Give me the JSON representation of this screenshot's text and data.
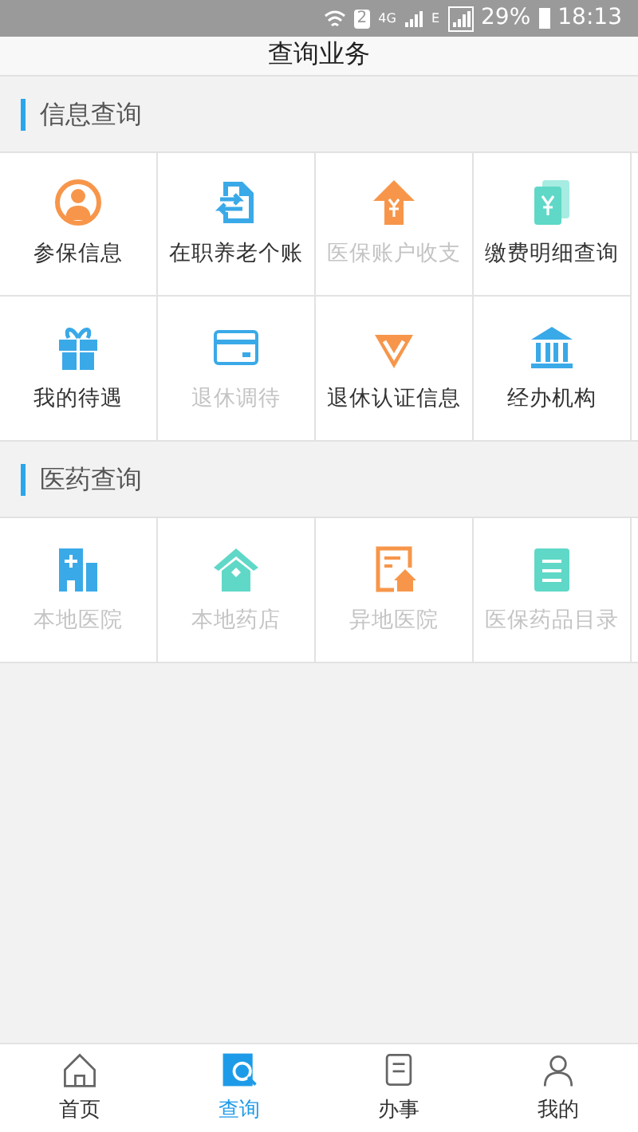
{
  "status_bar": {
    "sim": "2",
    "network": "4G",
    "network_2": "E",
    "battery": "29%",
    "time": "18:13"
  },
  "header": {
    "title": "查询业务"
  },
  "sections": [
    {
      "title": "信息查询",
      "items": [
        {
          "label": "参保信息",
          "disabled": false,
          "kind": "person"
        },
        {
          "label": "在职养老个账",
          "disabled": false,
          "kind": "transfer"
        },
        {
          "label": "医保账户收支",
          "disabled": true,
          "kind": "upload"
        },
        {
          "label": "缴费明细查询",
          "disabled": false,
          "kind": "bill"
        },
        {
          "label": "我的待遇",
          "disabled": false,
          "kind": "gift"
        },
        {
          "label": "退休调待",
          "disabled": true,
          "kind": "card"
        },
        {
          "label": "退休认证信息",
          "disabled": false,
          "kind": "diamond"
        },
        {
          "label": "经办机构",
          "disabled": false,
          "kind": "bank"
        }
      ]
    },
    {
      "title": "医药查询",
      "items": [
        {
          "label": "本地医院",
          "disabled": true,
          "kind": "hospital"
        },
        {
          "label": "本地药店",
          "disabled": true,
          "kind": "house"
        },
        {
          "label": "异地医院",
          "disabled": true,
          "kind": "dochouse"
        },
        {
          "label": "医保药品目录",
          "disabled": true,
          "kind": "list"
        }
      ]
    }
  ],
  "tabs": [
    {
      "label": "首页",
      "selected": false,
      "kind": "home"
    },
    {
      "label": "查询",
      "selected": true,
      "kind": "search"
    },
    {
      "label": "办事",
      "selected": false,
      "kind": "task"
    },
    {
      "label": "我的",
      "selected": false,
      "kind": "user"
    }
  ]
}
